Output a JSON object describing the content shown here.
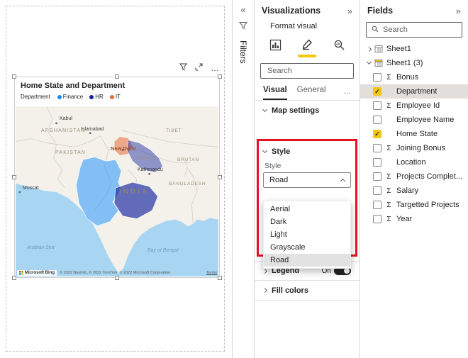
{
  "colors": {
    "accent": "#F2C811",
    "highlight_box": "#E81123",
    "finance": "#118DFF",
    "hr": "#12239E",
    "it": "#E66C37"
  },
  "icons": {
    "sigma": "Σ",
    "check": "✓",
    "collapse_left": "«",
    "collapse_right": "»",
    "more": "…"
  },
  "canvas": {
    "visual": {
      "title": "Home State and Department",
      "legend": {
        "title": "Department",
        "items": [
          {
            "label": "Finance",
            "color": "#118DFF"
          },
          {
            "label": "HR",
            "color": "#12239E"
          },
          {
            "label": "IT",
            "color": "#E66C37"
          }
        ]
      },
      "map": {
        "cities": [
          "Kabul",
          "Islamabad",
          "New Delhi",
          "Kathmandu",
          "Muscat"
        ],
        "regions": [
          "AFGHANISTAN",
          "PAKISTAN",
          "TIBET",
          "NEPAL",
          "BHUTAN",
          "BANGLADESH",
          "INDIA"
        ],
        "seas": [
          "Arabian Sea",
          "Bay of Bengal"
        ],
        "bing_label": "Microsoft Bing",
        "attribution": "© 2022 NavInfo, © 2022 TomTom, © 2022 Microsoft Corporation",
        "terms": "Terms"
      }
    }
  },
  "filters_pane": {
    "title": "Filters"
  },
  "viz_pane": {
    "title": "Visualizations",
    "subtitle": "Format visual",
    "search_placeholder": "Search",
    "tabs": {
      "visual": "Visual",
      "general": "General"
    },
    "map_settings_label": "Map settings",
    "style": {
      "header": "Style",
      "label": "Style",
      "value": "Road",
      "options": [
        "Aerial",
        "Dark",
        "Light",
        "Grayscale",
        "Road"
      ],
      "selected_option": "Road"
    },
    "legend_label": "Legend",
    "legend_state": "On",
    "fill_colors_label": "Fill colors"
  },
  "fields_pane": {
    "title": "Fields",
    "search_placeholder": "Search",
    "tables": [
      {
        "name": "Sheet1",
        "expanded": false
      },
      {
        "name": "Sheet1 (3)",
        "expanded": true
      }
    ],
    "fields": [
      {
        "name": "Bonus",
        "numeric": true,
        "checked": false
      },
      {
        "name": "Department",
        "numeric": false,
        "checked": true,
        "selected": true
      },
      {
        "name": "Employee Id",
        "numeric": true,
        "checked": false
      },
      {
        "name": "Employee Name",
        "numeric": false,
        "checked": false
      },
      {
        "name": "Home State",
        "numeric": false,
        "checked": true
      },
      {
        "name": "Joining Bonus",
        "numeric": true,
        "checked": false
      },
      {
        "name": "Location",
        "numeric": false,
        "checked": false
      },
      {
        "name": "Projects Complet...",
        "numeric": true,
        "checked": false
      },
      {
        "name": "Salary",
        "numeric": true,
        "checked": false
      },
      {
        "name": "Targetted Projects",
        "numeric": true,
        "checked": false
      },
      {
        "name": "Year",
        "numeric": true,
        "checked": false
      }
    ]
  }
}
